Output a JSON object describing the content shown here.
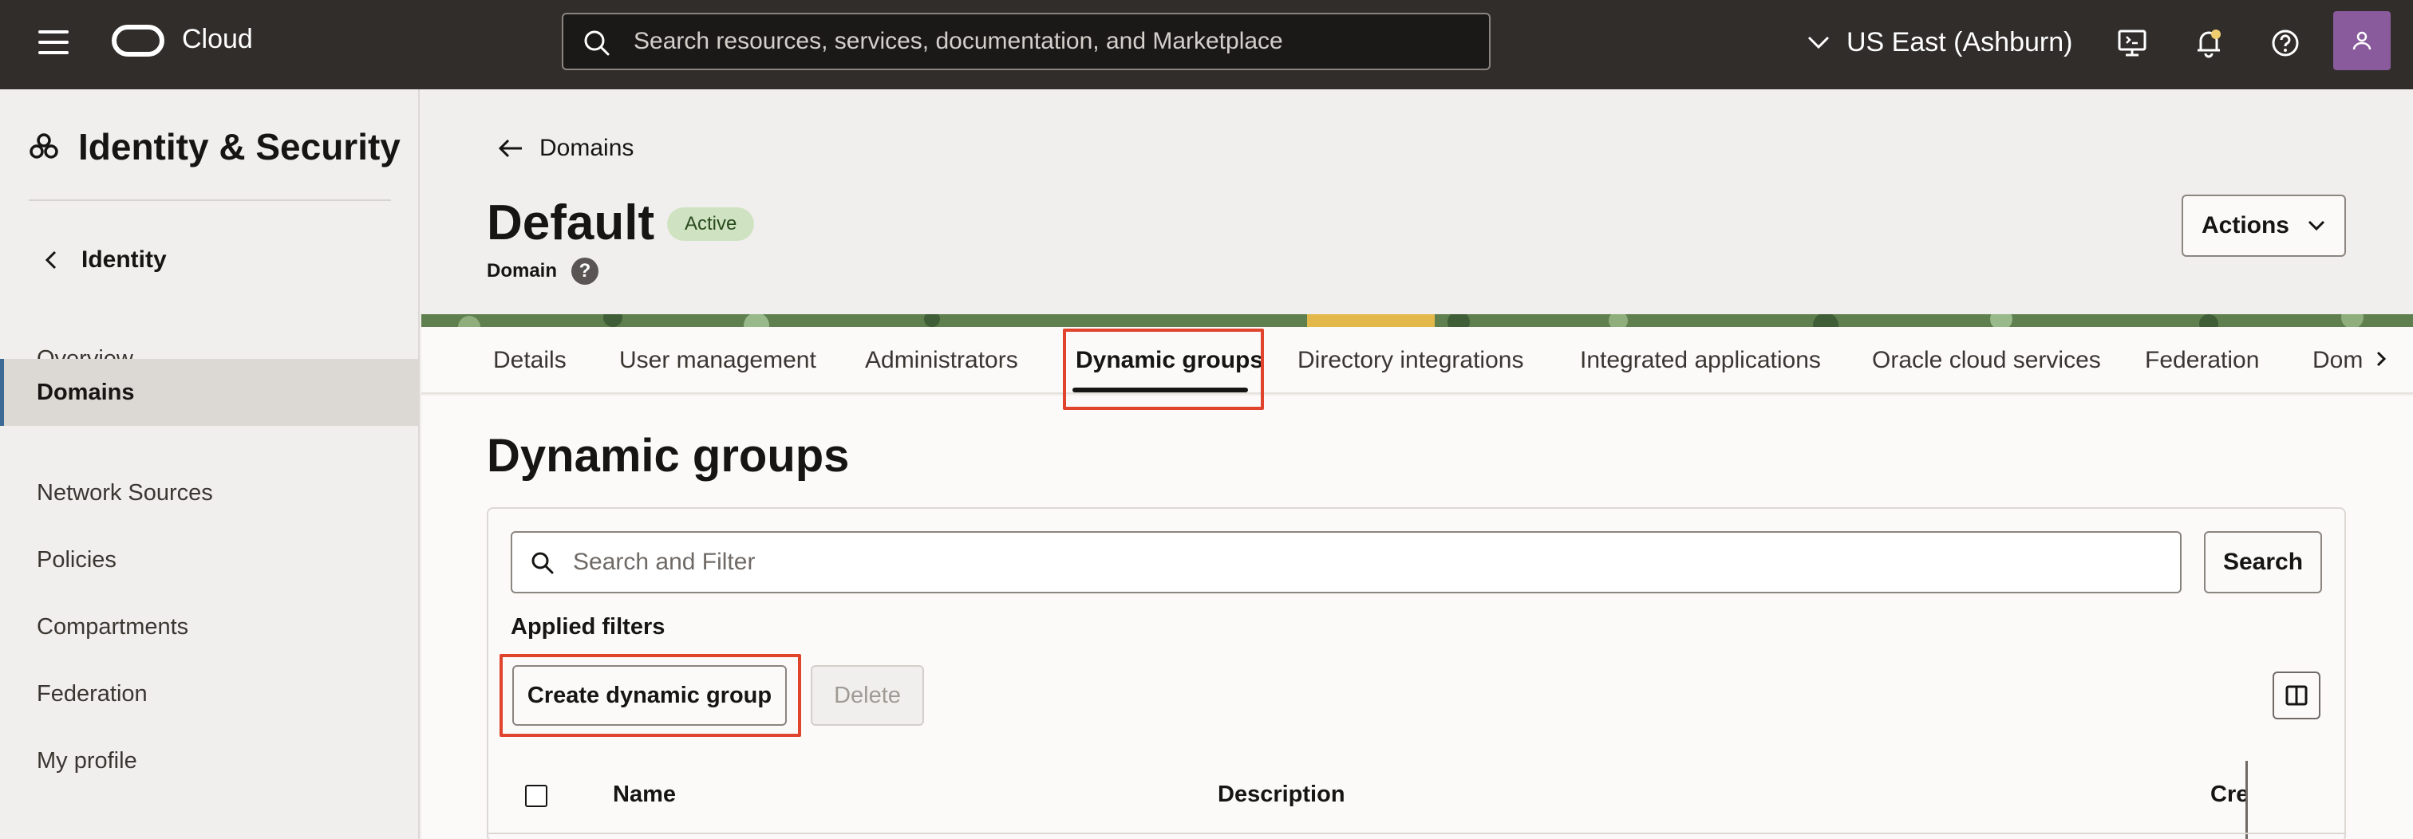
{
  "topbar": {
    "brand": "Cloud",
    "search_placeholder": "Search resources, services, documentation, and Marketplace",
    "region": "US East (Ashburn)",
    "icons": [
      "menu-icon",
      "cloud-shell-icon",
      "notifications-icon",
      "help-icon",
      "avatar"
    ]
  },
  "sidebar": {
    "title": "Identity & Security",
    "back_label": "Identity",
    "items": [
      {
        "label": "Overview"
      },
      {
        "label": "Domains"
      },
      {
        "label": "Network Sources"
      },
      {
        "label": "Policies"
      },
      {
        "label": "Compartments"
      },
      {
        "label": "Federation"
      },
      {
        "label": "My profile"
      }
    ]
  },
  "header": {
    "back_link": "Domains",
    "title": "Default",
    "status_badge": "Active",
    "subtitle": "Domain",
    "actions_label": "Actions"
  },
  "tabs": [
    {
      "label": "Details"
    },
    {
      "label": "User management"
    },
    {
      "label": "Administrators"
    },
    {
      "label": "Dynamic groups"
    },
    {
      "label": "Directory integrations"
    },
    {
      "label": "Integrated applications"
    },
    {
      "label": "Oracle cloud services"
    },
    {
      "label": "Federation"
    },
    {
      "label": "Dom"
    }
  ],
  "main": {
    "section_title": "Dynamic groups",
    "filter_placeholder": "Search and Filter",
    "search_button": "Search",
    "applied_filters": "Applied filters",
    "create_button": "Create dynamic group",
    "delete_button": "Delete",
    "table": {
      "columns": [
        "Name",
        "Description",
        "Cre"
      ]
    }
  },
  "colors": {
    "topbar": "#312d2a",
    "highlight": "#e0442c",
    "badge_bg": "#cfe3c2",
    "active_nav_border": "#3d6a94"
  }
}
